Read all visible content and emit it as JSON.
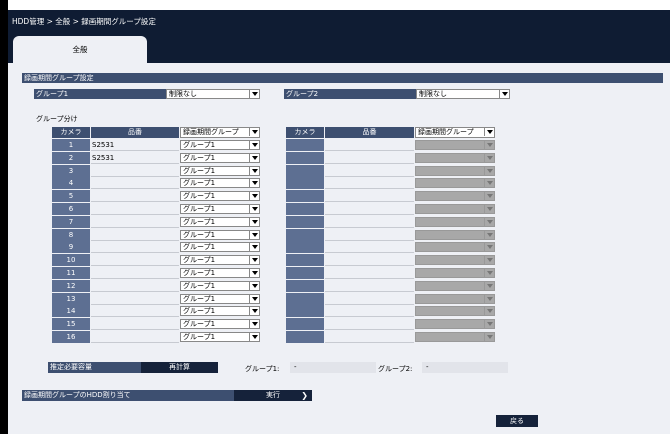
{
  "header": {
    "breadcrumb": "HDD管理 > 全般 > 録画期間グループ設定",
    "tab": "全般"
  },
  "recording_group_settings": {
    "title": "録画期間グループ設定",
    "group1_label": "グループ1",
    "group1_value": "制限なし",
    "group2_label": "グループ2",
    "group2_value": "制限なし"
  },
  "grouping": {
    "title": "グループ分け",
    "col_camera": "カメラ",
    "col_model": "品番",
    "col_group": "録画期間グループ",
    "rows": [
      {
        "cam": "1",
        "model": "S2531",
        "group": "グループ1"
      },
      {
        "cam": "2",
        "model": "S2531",
        "group": "グループ1"
      },
      {
        "cam": "3",
        "model": "",
        "group": "グループ1"
      },
      {
        "cam": "4",
        "model": "",
        "group": "グループ1"
      },
      {
        "cam": "5",
        "model": "",
        "group": "グループ1"
      },
      {
        "cam": "6",
        "model": "",
        "group": "グループ1"
      },
      {
        "cam": "7",
        "model": "",
        "group": "グループ1"
      },
      {
        "cam": "8",
        "model": "",
        "group": "グループ1"
      },
      {
        "cam": "9",
        "model": "",
        "group": "グループ1"
      },
      {
        "cam": "10",
        "model": "",
        "group": "グループ1"
      },
      {
        "cam": "11",
        "model": "",
        "group": "グループ1"
      },
      {
        "cam": "12",
        "model": "",
        "group": "グループ1"
      },
      {
        "cam": "13",
        "model": "",
        "group": "グループ1"
      },
      {
        "cam": "14",
        "model": "",
        "group": "グループ1"
      },
      {
        "cam": "15",
        "model": "",
        "group": "グループ1"
      },
      {
        "cam": "16",
        "model": "",
        "group": "グループ1"
      }
    ]
  },
  "capacity": {
    "label": "推定必要容量",
    "recalc_button": "再計算",
    "group1_label": "グループ1:",
    "group1_value": "-",
    "group2_label": "グループ2:",
    "group2_value": "-"
  },
  "hdd_assign": {
    "title": "録画期間グループのHDD割り当て",
    "execute_button": "実行"
  },
  "back_button": "戻る",
  "colors": {
    "header_bg": "#0f1c33",
    "panel_bg": "#eef0f5",
    "label_bg": "#3d4f70",
    "button_bg": "#15223a"
  }
}
